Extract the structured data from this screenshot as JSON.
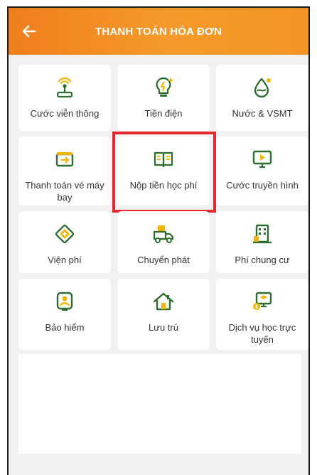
{
  "header": {
    "title": "THANH TOÁN HÓA ĐƠN",
    "back_icon": "arrow-left-icon"
  },
  "colors": {
    "header_orange": "#f59a2a",
    "icon_green": "#2c6e2f",
    "icon_accent": "#f5b400",
    "highlight_red": "#e4282d",
    "background": "#f1f1f1"
  },
  "services": [
    {
      "label": "Cước viễn thông",
      "icon": "antenna-icon"
    },
    {
      "label": "Tiền điện",
      "icon": "lightbulb-icon"
    },
    {
      "label": "Nước & VSMT",
      "icon": "water-drop-icon"
    },
    {
      "label": "Thanh toán vé máy bay",
      "icon": "plane-ticket-icon"
    },
    {
      "label": "Nộp tiền học phí",
      "icon": "open-book-icon",
      "highlighted": true
    },
    {
      "label": "Cước truyền hình",
      "icon": "tv-play-icon"
    },
    {
      "label": "Viện phí",
      "icon": "medical-cross-icon"
    },
    {
      "label": "Chuyển phát",
      "icon": "delivery-truck-icon"
    },
    {
      "label": "Phí chung cư",
      "icon": "apartment-building-icon"
    },
    {
      "label": "Bảo hiểm",
      "icon": "insurance-person-icon"
    },
    {
      "label": "Lưu trú",
      "icon": "house-icon"
    },
    {
      "label": "Dịch vụ học trực tuyến",
      "icon": "online-learning-icon"
    }
  ]
}
